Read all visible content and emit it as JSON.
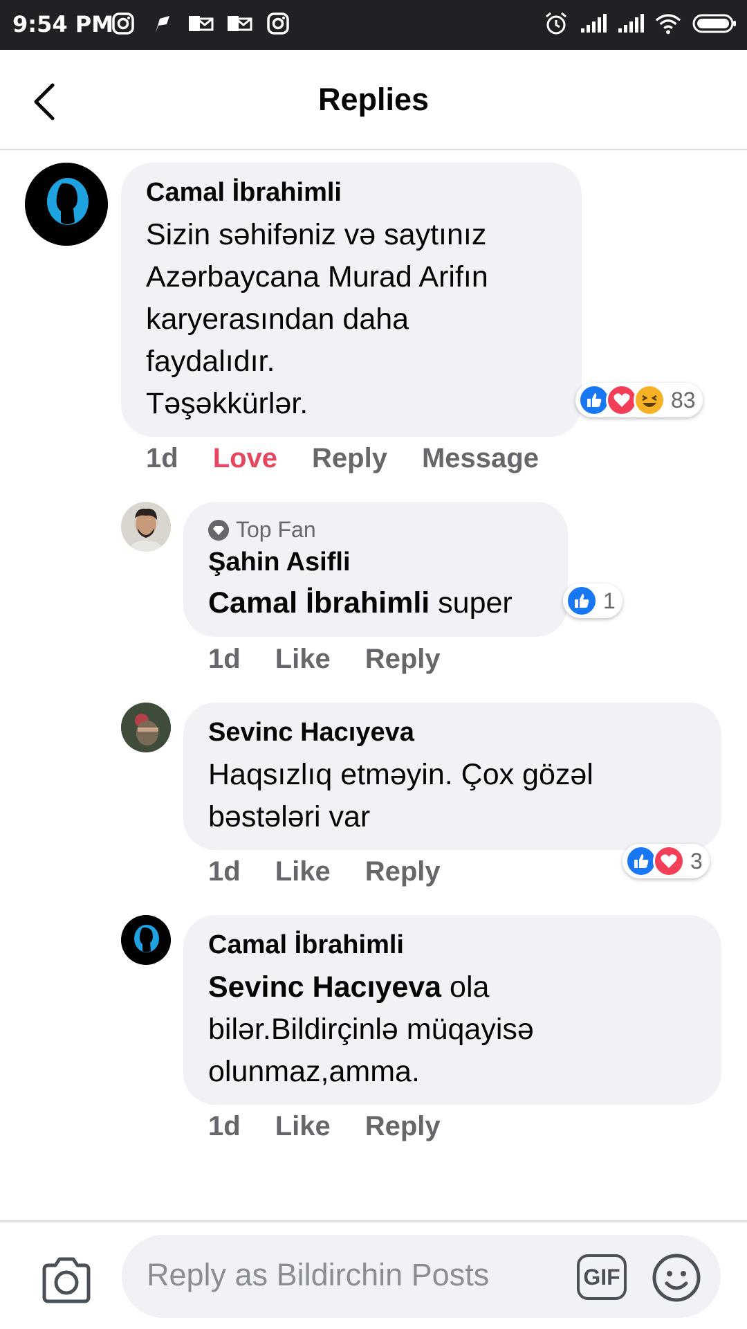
{
  "status_bar": {
    "time": "9:54 PM",
    "left_icons": [
      "instagram-icon",
      "flag-icon",
      "mail-icon",
      "mail-icon",
      "instagram-icon"
    ],
    "right_icons": [
      "alarm-icon",
      "signal-icon",
      "signal-icon",
      "wifi-icon",
      "battery-icon"
    ]
  },
  "header": {
    "title": "Replies",
    "back_icon": "back-arrow-icon"
  },
  "comments": [
    {
      "author": "Camal İbrahimli",
      "lines": [
        "Sizin səhifəniz və saytınız",
        "Azərbaycana Murad Arifın",
        "karyerasından daha",
        "faydalıdır.",
        "Təşəkkürlər."
      ],
      "time": "1d",
      "actions": [
        "Love",
        "Reply",
        "Message"
      ],
      "reactions": {
        "types": [
          "like",
          "love",
          "haha"
        ],
        "count": "83"
      }
    },
    {
      "badge": "Top Fan",
      "author": "Şahin Asifli",
      "mention": "Camal İbrahimli",
      "text": " super",
      "time": "1d",
      "actions": [
        "Like",
        "Reply"
      ],
      "reactions": {
        "types": [
          "like"
        ],
        "count": "1"
      }
    },
    {
      "author": "Sevinc Hacıyeva",
      "lines": [
        "Haqsızlıq etməyin. Çox gözəl",
        "bəstələri var"
      ],
      "time": "1d",
      "actions": [
        "Like",
        "Reply"
      ],
      "reactions": {
        "types": [
          "like",
          "love"
        ],
        "count": "3"
      }
    },
    {
      "author": "Camal İbrahimli",
      "mention": "Sevinc Hacıyeva",
      "text_first": " ola",
      "lines": [
        "bilər.Bildirçinlə müqayisə",
        "olunmaz,amma."
      ],
      "time": "1d",
      "actions": [
        "Like",
        "Reply"
      ]
    }
  ],
  "composer": {
    "placeholder": "Reply as Bildirchin Posts",
    "gif_label": "GIF",
    "camera_icon": "camera-icon",
    "emoji_icon": "emoji-icon"
  },
  "colors": {
    "love_action": "#e4475f",
    "like": "#1877f2",
    "love": "#f33e58",
    "haha": "#f7b125",
    "bubble": "#f0f2f5"
  }
}
